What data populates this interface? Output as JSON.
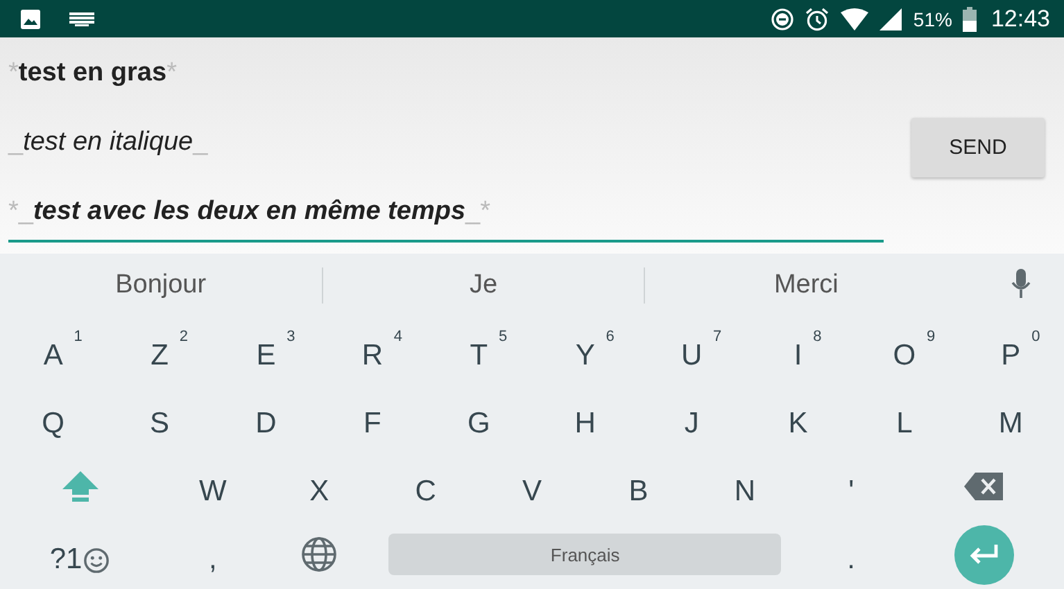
{
  "status_bar": {
    "battery_text": "51%",
    "time": "12:43"
  },
  "composer": {
    "lines": [
      {
        "kind": "bold",
        "open": "*",
        "text": "test en gras",
        "close": "*"
      },
      {
        "kind": "italic",
        "open": "_",
        "text": "test en italique",
        "close": "_"
      },
      {
        "kind": "bold-italic",
        "open": "*_",
        "text": "test avec les deux en même temps",
        "close": "_*"
      }
    ],
    "send_label": "SEND"
  },
  "suggestions": [
    "Bonjour",
    "Je",
    "Merci"
  ],
  "keyboard": {
    "shift_on": true,
    "rows": [
      {
        "keys": [
          {
            "kind": "letter",
            "label": "A",
            "hint": "1"
          },
          {
            "kind": "letter",
            "label": "Z",
            "hint": "2"
          },
          {
            "kind": "letter",
            "label": "E",
            "hint": "3"
          },
          {
            "kind": "letter",
            "label": "R",
            "hint": "4"
          },
          {
            "kind": "letter",
            "label": "T",
            "hint": "5"
          },
          {
            "kind": "letter",
            "label": "Y",
            "hint": "6"
          },
          {
            "kind": "letter",
            "label": "U",
            "hint": "7"
          },
          {
            "kind": "letter",
            "label": "I",
            "hint": "8"
          },
          {
            "kind": "letter",
            "label": "O",
            "hint": "9"
          },
          {
            "kind": "letter",
            "label": "P",
            "hint": "0"
          }
        ]
      },
      {
        "keys": [
          {
            "kind": "letter",
            "label": "Q"
          },
          {
            "kind": "letter",
            "label": "S"
          },
          {
            "kind": "letter",
            "label": "D"
          },
          {
            "kind": "letter",
            "label": "F"
          },
          {
            "kind": "letter",
            "label": "G"
          },
          {
            "kind": "letter",
            "label": "H"
          },
          {
            "kind": "letter",
            "label": "J"
          },
          {
            "kind": "letter",
            "label": "K"
          },
          {
            "kind": "letter",
            "label": "L"
          },
          {
            "kind": "letter",
            "label": "M"
          }
        ]
      },
      {
        "keys": [
          {
            "kind": "shift"
          },
          {
            "kind": "letter",
            "label": "W"
          },
          {
            "kind": "letter",
            "label": "X"
          },
          {
            "kind": "letter",
            "label": "C"
          },
          {
            "kind": "letter",
            "label": "V"
          },
          {
            "kind": "letter",
            "label": "B"
          },
          {
            "kind": "letter",
            "label": "N"
          },
          {
            "kind": "letter",
            "label": "'"
          },
          {
            "kind": "backspace"
          }
        ]
      },
      {
        "keys": [
          {
            "kind": "symbols",
            "label": "?1"
          },
          {
            "kind": "letter",
            "label": ","
          },
          {
            "kind": "globe"
          },
          {
            "kind": "space",
            "label": "Français"
          },
          {
            "kind": "letter",
            "label": "."
          },
          {
            "kind": "enter"
          }
        ]
      }
    ]
  }
}
